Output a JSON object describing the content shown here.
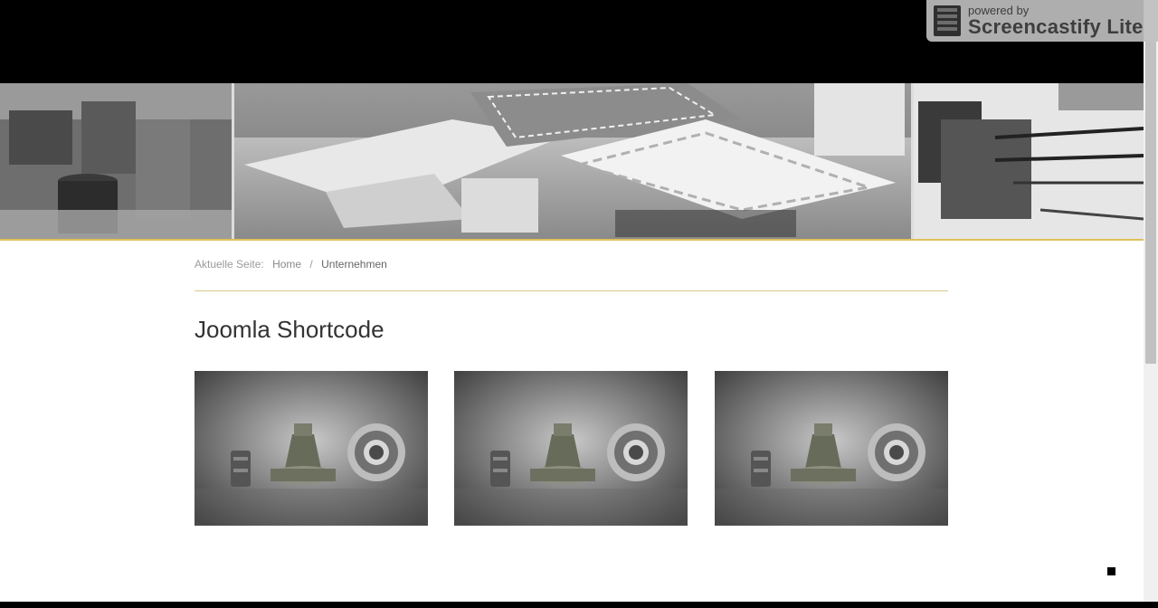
{
  "watermark": {
    "line1": "powered by",
    "line2": "Screencastify Lite",
    "icon": "film-strip-icon"
  },
  "breadcrumb": {
    "prefix": "Aktuelle Seite:",
    "home": "Home",
    "separator": "/",
    "current": "Unternehmen"
  },
  "page": {
    "title": "Joomla Shortcode"
  },
  "gallery": {
    "items": [
      "product-image",
      "product-image",
      "product-image"
    ]
  },
  "colors": {
    "accent": "#e0c05a",
    "divider": "#d8c98a"
  }
}
